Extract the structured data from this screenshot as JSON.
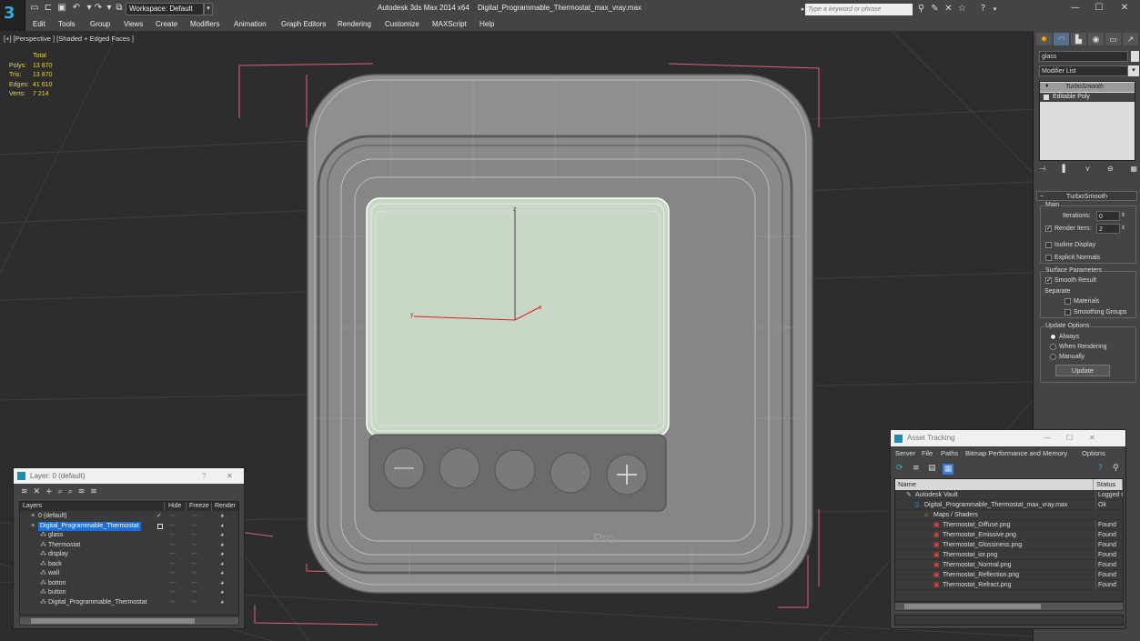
{
  "app": {
    "title": "Autodesk 3ds Max  2014 x64",
    "document": "Digital_Programmable_Thermostat_max_vray.max",
    "workspace": "Workspace: Default",
    "search_placeholder": "Type a keyword or phrase"
  },
  "menu": [
    "Edit",
    "Tools",
    "Group",
    "Views",
    "Create",
    "Modifiers",
    "Animation",
    "Graph Editors",
    "Rendering",
    "Customize",
    "MAXScript",
    "Help"
  ],
  "viewport": {
    "label": "[+] [Perspective ] [Shaded + Edged Faces ]",
    "stats": {
      "header": "Total",
      "rows": [
        {
          "label": "Polys:",
          "value": "13 870"
        },
        {
          "label": "Tris:",
          "value": "13 870"
        },
        {
          "label": "Edges:",
          "value": "41 610"
        },
        {
          "label": "Verts:",
          "value": "7 214"
        }
      ]
    },
    "axis": {
      "x": "x",
      "y": "y",
      "z": "z"
    },
    "device_logo": "Pro"
  },
  "command_panel": {
    "object_name": "glass",
    "modifier_list": "Modifier List",
    "stack": [
      "TurboSmooth",
      "Editable Poly"
    ],
    "rollout_title": "TurboSmooth",
    "main": {
      "title": "Main",
      "iterations_label": "Iterations:",
      "iterations_value": "0",
      "render_iters_label": "Render Iters:",
      "render_iters_value": "2",
      "isoline": "Isoline Display",
      "explicit": "Explicit Normals"
    },
    "surface": {
      "title": "Surface Parameters",
      "smooth": "Smooth Result",
      "separate": "Separate",
      "materials": "Materials",
      "smoothing": "Smoothing Groups"
    },
    "update": {
      "title": "Update Options",
      "always": "Always",
      "when_rendering": "When Rendering",
      "manually": "Manually",
      "button": "Update"
    }
  },
  "layer_window": {
    "title": "Layer: 0 (default)",
    "help": "?",
    "columns": [
      "Layers",
      "Hide",
      "Freeze",
      "Render"
    ],
    "rows": [
      {
        "name": "0 (default)",
        "indent": 1
      },
      {
        "name": "Digital_Programmable_Thermostat",
        "indent": 1,
        "selected": true
      },
      {
        "name": "glass",
        "indent": 2
      },
      {
        "name": "Thermostat",
        "indent": 2
      },
      {
        "name": "display",
        "indent": 2
      },
      {
        "name": "back",
        "indent": 2
      },
      {
        "name": "wall",
        "indent": 2
      },
      {
        "name": "botton",
        "indent": 2
      },
      {
        "name": "button",
        "indent": 2
      },
      {
        "name": "Digital_Programmable_Thermostat",
        "indent": 2
      }
    ]
  },
  "asset_window": {
    "title": "Asset Tracking",
    "menu": [
      "Server",
      "File",
      "Paths",
      "Bitmap Performance and Memory",
      "Options"
    ],
    "columns": [
      "Name",
      "Status"
    ],
    "rows": [
      {
        "name": "Autodesk Vault",
        "status": "Logged O",
        "indent": 1
      },
      {
        "name": "Digital_Programmable_Thermostat_max_vray.max",
        "status": "Ok",
        "indent": 2
      },
      {
        "name": "Maps / Shaders",
        "status": "",
        "indent": 3
      },
      {
        "name": "Thermostat_Diffuse.png",
        "status": "Found",
        "indent": 4
      },
      {
        "name": "Thermostat_Emissive.png",
        "status": "Found",
        "indent": 4
      },
      {
        "name": "Thermostat_Glossiness.png",
        "status": "Found",
        "indent": 4
      },
      {
        "name": "Thermostat_ior.png",
        "status": "Found",
        "indent": 4
      },
      {
        "name": "Thermostat_Normal.png",
        "status": "Found",
        "indent": 4
      },
      {
        "name": "Thermostat_Reflection.png",
        "status": "Found",
        "indent": 4
      },
      {
        "name": "Thermostat_Refract.png",
        "status": "Found",
        "indent": 4
      }
    ]
  },
  "colors": {
    "selection": "#1e6fd6",
    "stats_text": "#e8d44a",
    "bounding_box": "#e0607a",
    "screen": "#c9d8c6"
  }
}
